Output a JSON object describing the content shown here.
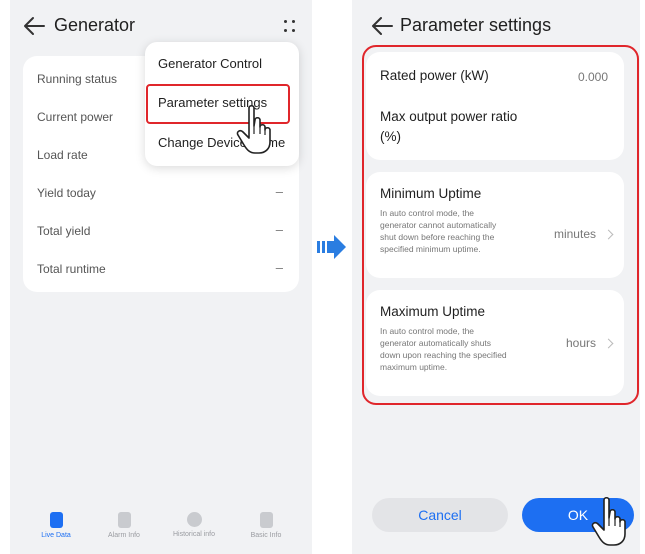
{
  "left": {
    "title": "Generator",
    "rows": [
      {
        "label": "Running status",
        "value": ""
      },
      {
        "label": "Current power",
        "value": ""
      },
      {
        "label": "Load rate",
        "value": ""
      },
      {
        "label": "Yield today",
        "value": "–"
      },
      {
        "label": "Total yield",
        "value": "–"
      },
      {
        "label": "Total runtime",
        "value": "–"
      }
    ],
    "menu": {
      "items": [
        "Generator Control",
        "Parameter settings",
        "Change Device Name"
      ],
      "selected_index": 1
    },
    "tabs": [
      {
        "label": "Live Data",
        "icon": "live-data-icon",
        "active": true
      },
      {
        "label": "Alarm Info",
        "icon": "alarm-icon",
        "active": false
      },
      {
        "label": "Historical info",
        "icon": "history-icon",
        "active": false
      },
      {
        "label": "Basic Info",
        "icon": "info-icon",
        "active": false
      }
    ]
  },
  "right": {
    "title": "Parameter settings",
    "rated_power": {
      "label": "Rated power (kW)",
      "value": "0.000"
    },
    "max_output": {
      "label": "Max output power ratio",
      "label2": "(%)"
    },
    "min_uptime": {
      "label": "Minimum Uptime",
      "desc": [
        "In auto control mode, the",
        "generator cannot automatically",
        "shut down before reaching the",
        "specified minimum uptime."
      ],
      "unit": "minutes"
    },
    "max_uptime": {
      "label": "Maximum Uptime",
      "desc": [
        "In auto control mode, the",
        "generator automatically shuts",
        "down upon reaching the specified",
        "maximum uptime."
      ],
      "unit": "hours"
    },
    "cancel_label": "Cancel",
    "ok_label": "OK"
  },
  "colors": {
    "accent": "#1d6ff2",
    "highlight": "#e0262b",
    "background": "#f1f2f4"
  }
}
